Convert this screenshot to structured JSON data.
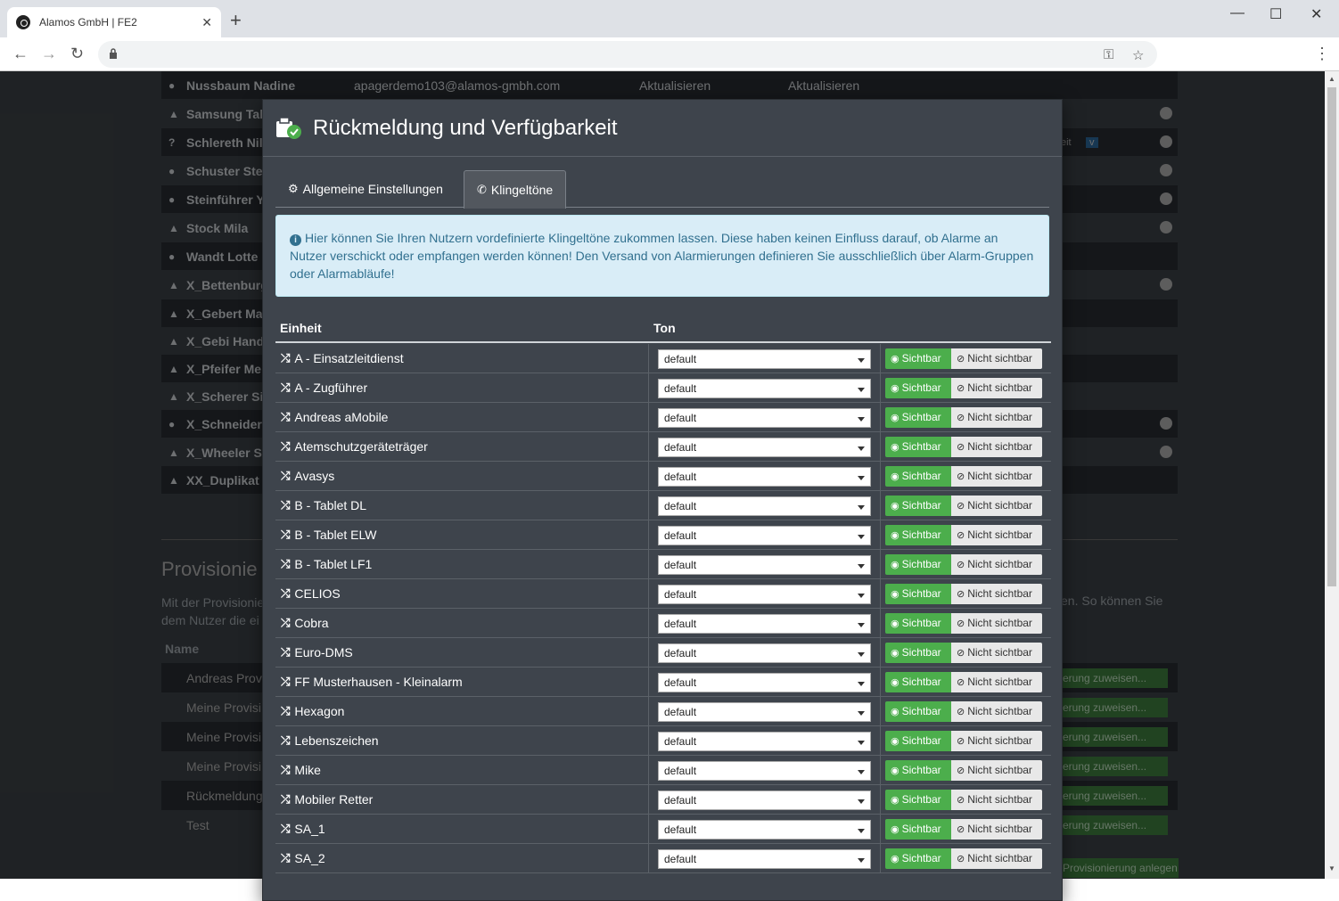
{
  "browser": {
    "tab_title": "Alamos GmbH | FE2",
    "close": "✕",
    "new_tab": "+",
    "win_min": "—",
    "win_max": "☐",
    "win_close": "✕",
    "back": "←",
    "forward": "→",
    "reload": "↻",
    "key": "⚿",
    "star": "☆",
    "menu": "⋮"
  },
  "background": {
    "rows": [
      {
        "name": "Nussbaum Nadine",
        "email": "apagerdemo103@alamos-gmbh.com",
        "act1": "Aktualisieren",
        "act2": "Aktualisieren"
      },
      {
        "name": "Samsung Tal"
      },
      {
        "name": "Schlereth Nil"
      },
      {
        "name": "Schuster Ste"
      },
      {
        "name": "Steinführer Y"
      },
      {
        "name": "Stock Mila"
      },
      {
        "name": "Wandt Lotte"
      },
      {
        "name": "X_Bettenburg"
      },
      {
        "name": "X_Gebert Ma"
      },
      {
        "name": "X_Gebi Hand"
      },
      {
        "name": "X_Pfeifer Me"
      },
      {
        "name": "X_Scherer Si"
      },
      {
        "name": "X_Schneider"
      },
      {
        "name": "X_Wheeler S"
      },
      {
        "name": "XX_Duplikat"
      }
    ],
    "badge_eit": "eit",
    "badge_v": "v",
    "section_title": "Provisionie",
    "section_text_1": "Mit der Provisionie",
    "section_text_2": "dem Nutzer die ei",
    "section_text_right": "en. So können Sie",
    "name_header": "Name",
    "prov_rows": [
      "Andreas Prov",
      "Meine Provisi",
      "Meine Provisi",
      "Meine Provisi",
      "Rückmeldung",
      "Test"
    ],
    "assign_label": "erung zuweisen...",
    "create_label": "Provisionierung anlegen"
  },
  "modal": {
    "title": "Rückmeldung und Verfügbarkeit",
    "tabs": [
      {
        "label": "Allgemeine Einstellungen",
        "icon": "⚙"
      },
      {
        "label": "Klingeltöne",
        "icon": "✆"
      }
    ],
    "info_icon": "i",
    "info_text": "Hier können Sie Ihren Nutzern vordefinierte Klingeltöne zukommen lassen. Diese haben keinen Einfluss darauf, ob Alarme an Nutzer verschickt oder empfangen werden können! Den Versand von Alarmierungen definieren Sie ausschließlich über Alarm-Gruppen oder Alarmabläufe!",
    "col_unit": "Einheit",
    "col_tone": "Ton",
    "visible_label": "Sichtbar",
    "invisible_label": "Nicht sichtbar",
    "shuffle_icon": "⤮",
    "eye_icon": "◉",
    "eye_off_icon": "⊘",
    "rows": [
      {
        "unit": "A - Einsatzleitdienst",
        "tone": "default"
      },
      {
        "unit": "A - Zugführer",
        "tone": "default"
      },
      {
        "unit": "Andreas aMobile",
        "tone": "default"
      },
      {
        "unit": "Atemschutzgeräteträger",
        "tone": "default"
      },
      {
        "unit": "Avasys",
        "tone": "default"
      },
      {
        "unit": "B - Tablet DL",
        "tone": "default"
      },
      {
        "unit": "B - Tablet ELW",
        "tone": "default"
      },
      {
        "unit": "B - Tablet LF1",
        "tone": "default"
      },
      {
        "unit": "CELIOS",
        "tone": "default"
      },
      {
        "unit": "Cobra",
        "tone": "default"
      },
      {
        "unit": "Euro-DMS",
        "tone": "default"
      },
      {
        "unit": "FF Musterhausen - Kleinalarm",
        "tone": "default"
      },
      {
        "unit": "Hexagon",
        "tone": "default"
      },
      {
        "unit": "Lebenszeichen",
        "tone": "default"
      },
      {
        "unit": "Mike",
        "tone": "default"
      },
      {
        "unit": "Mobiler Retter",
        "tone": "default"
      },
      {
        "unit": "SA_1",
        "tone": "default"
      },
      {
        "unit": "SA_2",
        "tone": "default"
      }
    ]
  }
}
